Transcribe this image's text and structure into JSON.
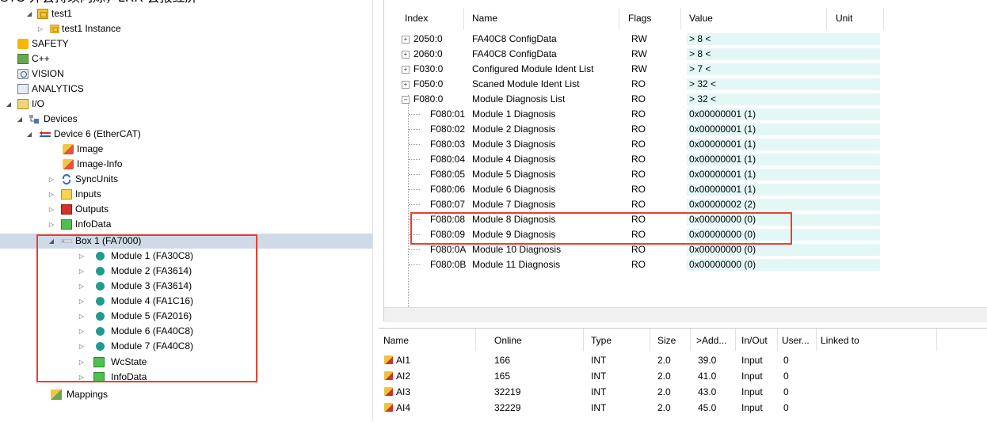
{
  "caption": "STO 外会持续闪烁，LRR 会报红屏",
  "tree": {
    "items": [
      {
        "label": "test1",
        "icon": "project-icon"
      },
      {
        "label": "test1 Instance",
        "icon": "project-instance-icon"
      },
      {
        "label": "SAFETY",
        "icon": "safety-icon"
      },
      {
        "label": "C++",
        "icon": "cpp-icon"
      },
      {
        "label": "VISION",
        "icon": "vision-icon"
      },
      {
        "label": "ANALYTICS",
        "icon": "analytics-icon"
      },
      {
        "label": "I/O",
        "icon": "io-icon"
      },
      {
        "label": "Devices",
        "icon": "devices-icon"
      },
      {
        "label": "Device 6 (EtherCAT)",
        "icon": "ethercat-device-icon"
      },
      {
        "label": "Image",
        "icon": "image-icon"
      },
      {
        "label": "Image-Info",
        "icon": "image-info-icon"
      },
      {
        "label": "SyncUnits",
        "icon": "syncunits-icon"
      },
      {
        "label": "Inputs",
        "icon": "inputs-icon"
      },
      {
        "label": "Outputs",
        "icon": "outputs-icon"
      },
      {
        "label": "InfoData",
        "icon": "infodata-icon"
      },
      {
        "label": "Box 1 (FA7000)",
        "icon": "box-icon"
      },
      {
        "label": "Module 1 (FA30C8)",
        "icon": "module-icon"
      },
      {
        "label": "Module 2 (FA3614)",
        "icon": "module-icon"
      },
      {
        "label": "Module 3 (FA3614)",
        "icon": "module-icon"
      },
      {
        "label": "Module 4 (FA1C16)",
        "icon": "module-icon"
      },
      {
        "label": "Module 5 (FA2016)",
        "icon": "module-icon"
      },
      {
        "label": "Module 6 (FA40C8)",
        "icon": "module-icon"
      },
      {
        "label": "Module 7 (FA40C8)",
        "icon": "module-icon"
      },
      {
        "label": "WcState",
        "icon": "wcstate-icon"
      },
      {
        "label": "InfoData",
        "icon": "infodata-icon"
      },
      {
        "label": "Mappings",
        "icon": "mappings-icon"
      }
    ]
  },
  "upper_grid": {
    "headers": [
      "Index",
      "Name",
      "Flags",
      "Value",
      "Unit"
    ],
    "rows": [
      {
        "index": "2050:0",
        "name": "FA40C8 ConfigData",
        "flags": "RW",
        "value": "> 8 <",
        "expand": "+"
      },
      {
        "index": "2060:0",
        "name": "FA40C8 ConfigData",
        "flags": "RW",
        "value": "> 8 <",
        "expand": "+"
      },
      {
        "index": "F030:0",
        "name": "Configured Module Ident List",
        "flags": "RW",
        "value": "> 7 <",
        "expand": "+"
      },
      {
        "index": "F050:0",
        "name": "Scaned Module Ident List",
        "flags": "RO",
        "value": "> 32 <",
        "expand": "+"
      },
      {
        "index": "F080:0",
        "name": "Module Diagnosis List",
        "flags": "RO",
        "value": "> 32 <",
        "expand": "−"
      },
      {
        "index": "F080:01",
        "name": "Module 1 Diagnosis",
        "flags": "RO",
        "value": "0x00000001 (1)"
      },
      {
        "index": "F080:02",
        "name": "Module 2 Diagnosis",
        "flags": "RO",
        "value": "0x00000001 (1)"
      },
      {
        "index": "F080:03",
        "name": "Module 3 Diagnosis",
        "flags": "RO",
        "value": "0x00000001 (1)"
      },
      {
        "index": "F080:04",
        "name": "Module 4 Diagnosis",
        "flags": "RO",
        "value": "0x00000001 (1)"
      },
      {
        "index": "F080:05",
        "name": "Module 5 Diagnosis",
        "flags": "RO",
        "value": "0x00000001 (1)"
      },
      {
        "index": "F080:06",
        "name": "Module 6 Diagnosis",
        "flags": "RO",
        "value": "0x00000001 (1)"
      },
      {
        "index": "F080:07",
        "name": "Module 7 Diagnosis",
        "flags": "RO",
        "value": "0x00000002 (2)"
      },
      {
        "index": "F080:08",
        "name": "Module 8 Diagnosis",
        "flags": "RO",
        "value": "0x00000000 (0)"
      },
      {
        "index": "F080:09",
        "name": "Module 9 Diagnosis",
        "flags": "RO",
        "value": "0x00000000 (0)"
      },
      {
        "index": "F080:0A",
        "name": "Module 10 Diagnosis",
        "flags": "RO",
        "value": "0x00000000 (0)"
      },
      {
        "index": "F080:0B",
        "name": "Module 11 Diagnosis",
        "flags": "RO",
        "value": "0x00000000 (0)"
      }
    ]
  },
  "lower_grid": {
    "headers": [
      "Name",
      "Online",
      "Type",
      "Size",
      ">Add...",
      "In/Out",
      "User...",
      "Linked to"
    ],
    "rows": [
      {
        "name": "AI1",
        "online": "166",
        "type": "INT",
        "size": "2.0",
        "addr": "39.0",
        "inout": "Input",
        "user": "0"
      },
      {
        "name": "AI2",
        "online": "165",
        "type": "INT",
        "size": "2.0",
        "addr": "41.0",
        "inout": "Input",
        "user": "0"
      },
      {
        "name": "AI3",
        "online": "32219",
        "type": "INT",
        "size": "2.0",
        "addr": "43.0",
        "inout": "Input",
        "user": "0"
      },
      {
        "name": "AI4",
        "online": "32229",
        "type": "INT",
        "size": "2.0",
        "addr": "45.0",
        "inout": "Input",
        "user": "0"
      }
    ]
  },
  "colors": {
    "highlight_box": "#e8412c",
    "selected_row": "#cfd9e8",
    "value_highlight": "#e4f7f7"
  }
}
